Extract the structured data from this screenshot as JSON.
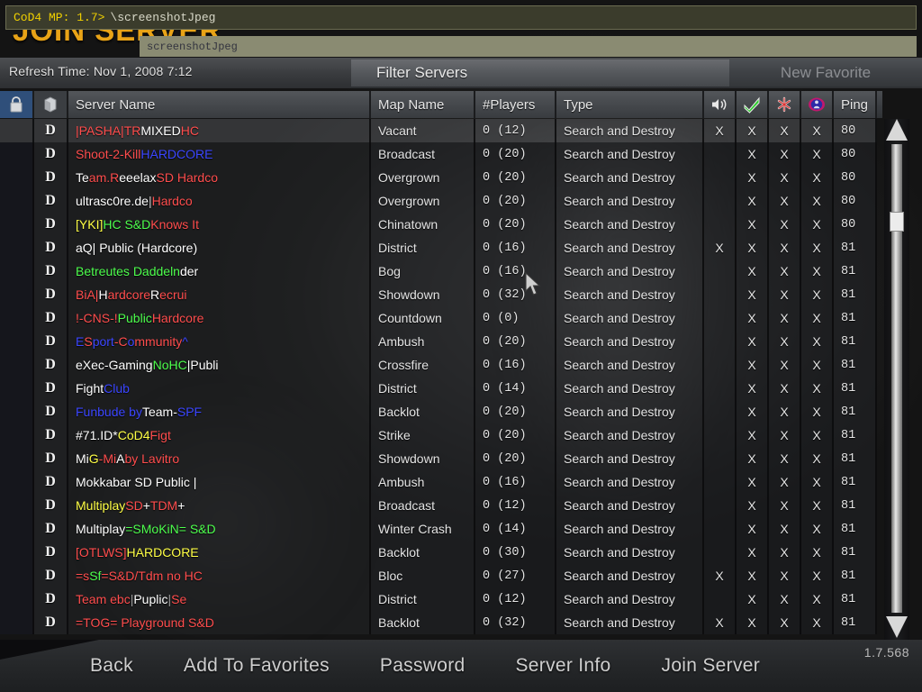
{
  "page_title": "JOIN SERVER",
  "console": {
    "prompt": "CoD4 MP: 1.7>",
    "command": "\\screenshotJpeg",
    "suggestion": "screenshotJpeg"
  },
  "refresh_time": "Refresh Time: Nov 1, 2008  7:12",
  "buttons": {
    "filter_servers": "Filter Servers",
    "new_favorite": "New Favorite"
  },
  "columns": {
    "lock_icon": "padlock-icon",
    "mod_icon": "cube-icon",
    "server_name": "Server Name",
    "map_name": "Map Name",
    "players": "#Players",
    "type": "Type",
    "voice_icon": "speaker-icon",
    "punkbuster_icon": "green-check-icon",
    "mod_star_icon": "red-asterisk-icon",
    "pure_icon": "person-globe-icon",
    "ping": "Ping"
  },
  "colors": {
    "title": "#e8a317",
    "console_bg": "#3b3c2c",
    "console_text": "#f0d000",
    "selected_row": "rgba(130,132,140,.30)",
    "cod_red": "#ff4d4d",
    "cod_green": "#4dff4d",
    "cod_blue": "#3b46ff",
    "cod_yellow": "#ffff45",
    "cod_white": "#ffffff"
  },
  "rows": [
    {
      "mod": "D",
      "name_parts": [
        {
          "t": "|PASHA|",
          "c": "#ff4d4d"
        },
        {
          "t": "TR ",
          "c": "#ff4d4d"
        },
        {
          "t": "MIXED ",
          "c": "#ffffff"
        },
        {
          "t": "HC",
          "c": "#ff4d4d"
        }
      ],
      "map": "Vacant",
      "players": "0 (12)",
      "type": "Search and Destroy",
      "voice": "X",
      "pb": "X",
      "modx": "X",
      "pure": "X",
      "ping": "80",
      "selected": true
    },
    {
      "mod": "D",
      "name_parts": [
        {
          "t": "Shoot-2-Kill ",
          "c": "#ff4d4d"
        },
        {
          "t": "HARDCORE",
          "c": "#3b46ff"
        }
      ],
      "map": "Broadcast",
      "players": "0 (20)",
      "type": "Search and Destroy",
      "voice": "",
      "pb": "X",
      "modx": "X",
      "pure": "X",
      "ping": "80",
      "selected": false
    },
    {
      "mod": "D",
      "name_parts": [
        {
          "t": "Te",
          "c": "#ffffff"
        },
        {
          "t": "am.R",
          "c": "#ff4d4d"
        },
        {
          "t": "eeelax ",
          "c": "#ffffff"
        },
        {
          "t": "SD Hardco",
          "c": "#ff4d4d"
        }
      ],
      "map": "Overgrown",
      "players": "0 (20)",
      "type": "Search and Destroy",
      "voice": "",
      "pb": "X",
      "modx": "X",
      "pure": "X",
      "ping": "80",
      "selected": false
    },
    {
      "mod": "D",
      "name_parts": [
        {
          "t": "ultrasc0re.de ",
          "c": "#ffffff"
        },
        {
          "t": "| ",
          "c": "#c8c8c8"
        },
        {
          "t": "Hardco",
          "c": "#ff4d4d"
        }
      ],
      "map": "Overgrown",
      "players": "0 (20)",
      "type": "Search and Destroy",
      "voice": "",
      "pb": "X",
      "modx": "X",
      "pure": "X",
      "ping": "80",
      "selected": false
    },
    {
      "mod": "D",
      "name_parts": [
        {
          "t": "[YKI]",
          "c": "#ffff45"
        },
        {
          "t": "HC S&D ",
          "c": "#4dff4d"
        },
        {
          "t": "Knows It",
          "c": "#ff4d4d"
        }
      ],
      "map": "Chinatown",
      "players": "0 (20)",
      "type": "Search and Destroy",
      "voice": "",
      "pb": "X",
      "modx": "X",
      "pure": "X",
      "ping": "80",
      "selected": false
    },
    {
      "mod": "D",
      "name_parts": [
        {
          "t": "aQ| Public (Hardcore)",
          "c": "#ffffff"
        }
      ],
      "map": "District",
      "players": "0 (16)",
      "type": "Search and Destroy",
      "voice": "X",
      "pb": "X",
      "modx": "X",
      "pure": "X",
      "ping": "81",
      "selected": false
    },
    {
      "mod": "D",
      "name_parts": [
        {
          "t": "Betreutes Daddeln ",
          "c": "#4dff4d"
        },
        {
          "t": "der",
          "c": "#ffffff"
        }
      ],
      "map": "Bog",
      "players": "0 (16)",
      "type": "Search and Destroy",
      "voice": "",
      "pb": "X",
      "modx": "X",
      "pure": "X",
      "ping": "81",
      "selected": false
    },
    {
      "mod": "D",
      "name_parts": [
        {
          "t": "BiA|",
          "c": "#ff4d4d"
        },
        {
          "t": "H",
          "c": "#ffffff"
        },
        {
          "t": "ardcore ",
          "c": "#ff4d4d"
        },
        {
          "t": "R",
          "c": "#ffffff"
        },
        {
          "t": "ecrui",
          "c": "#ff4d4d"
        }
      ],
      "map": "Showdown",
      "players": "0 (32)",
      "type": "Search and Destroy",
      "voice": "",
      "pb": "X",
      "modx": "X",
      "pure": "X",
      "ping": "81",
      "selected": false
    },
    {
      "mod": "D",
      "name_parts": [
        {
          "t": "!-CNS-! ",
          "c": "#ff4d4d"
        },
        {
          "t": "Public",
          "c": "#4dff4d"
        },
        {
          "t": "Hardcore",
          "c": "#ff4d4d"
        }
      ],
      "map": "Countdown",
      "players": "0 (0)",
      "type": "Search and Destroy",
      "voice": "",
      "pb": "X",
      "modx": "X",
      "pure": "X",
      "ping": "81",
      "selected": false
    },
    {
      "mod": "D",
      "name_parts": [
        {
          "t": "E",
          "c": "#3b46ff"
        },
        {
          "t": "S",
          "c": "#ff4d4d"
        },
        {
          "t": "port",
          "c": "#3b46ff"
        },
        {
          "t": "-C",
          "c": "#ff4d4d"
        },
        {
          "t": "o",
          "c": "#3b46ff"
        },
        {
          "t": "mmunity",
          "c": "#ff4d4d"
        },
        {
          "t": "^",
          "c": "#3b46ff"
        }
      ],
      "map": "Ambush",
      "players": "0 (20)",
      "type": "Search and Destroy",
      "voice": "",
      "pb": "X",
      "modx": "X",
      "pure": "X",
      "ping": "81",
      "selected": false
    },
    {
      "mod": "D",
      "name_parts": [
        {
          "t": "eXec-Gaming ",
          "c": "#ffffff"
        },
        {
          "t": "NoHC",
          "c": "#4dff4d"
        },
        {
          "t": "|Publi",
          "c": "#ffffff"
        }
      ],
      "map": "Crossfire",
      "players": "0 (16)",
      "type": "Search and Destroy",
      "voice": "",
      "pb": "X",
      "modx": "X",
      "pure": "X",
      "ping": "81",
      "selected": false
    },
    {
      "mod": "D",
      "name_parts": [
        {
          "t": "Fight ",
          "c": "#ffffff"
        },
        {
          "t": "Club",
          "c": "#3b46ff"
        }
      ],
      "map": "District",
      "players": "0 (14)",
      "type": "Search and Destroy",
      "voice": "",
      "pb": "X",
      "modx": "X",
      "pure": "X",
      "ping": "81",
      "selected": false
    },
    {
      "mod": "D",
      "name_parts": [
        {
          "t": "Funbude by ",
          "c": "#3b46ff"
        },
        {
          "t": "Team-",
          "c": "#ffffff"
        },
        {
          "t": "SPF",
          "c": "#3b46ff"
        }
      ],
      "map": "Backlot",
      "players": "0 (20)",
      "type": "Search and Destroy",
      "voice": "",
      "pb": "X",
      "modx": "X",
      "pure": "X",
      "ping": "81",
      "selected": false
    },
    {
      "mod": "D",
      "name_parts": [
        {
          "t": "#71.ID* ",
          "c": "#ffffff"
        },
        {
          "t": "CoD4 ",
          "c": "#ffff45"
        },
        {
          "t": "Figt",
          "c": "#ff4d4d"
        }
      ],
      "map": "Strike",
      "players": "0 (20)",
      "type": "Search and Destroy",
      "voice": "",
      "pb": "X",
      "modx": "X",
      "pure": "X",
      "ping": "81",
      "selected": false
    },
    {
      "mod": "D",
      "name_parts": [
        {
          "t": "Mi",
          "c": "#ffffff"
        },
        {
          "t": "G",
          "c": "#ffff45"
        },
        {
          "t": "-Mi",
          "c": "#ff4d4d"
        },
        {
          "t": "A",
          "c": "#ffffff"
        },
        {
          "t": "  by Lavitro",
          "c": "#ff4d4d"
        }
      ],
      "map": "Showdown",
      "players": "0 (20)",
      "type": "Search and Destroy",
      "voice": "",
      "pb": "X",
      "modx": "X",
      "pure": "X",
      "ping": "81",
      "selected": false
    },
    {
      "mod": "D",
      "name_parts": [
        {
          "t": "Mokkabar SD Public |",
          "c": "#ffffff"
        }
      ],
      "map": "Ambush",
      "players": "0 (16)",
      "type": "Search and Destroy",
      "voice": "",
      "pb": "X",
      "modx": "X",
      "pure": "X",
      "ping": "81",
      "selected": false
    },
    {
      "mod": "D",
      "name_parts": [
        {
          "t": "Multiplay ",
          "c": "#ffff45"
        },
        {
          "t": "SD ",
          "c": "#ff4d4d"
        },
        {
          "t": "+ ",
          "c": "#ffffff"
        },
        {
          "t": "TDM ",
          "c": "#ff4d4d"
        },
        {
          "t": "+",
          "c": "#ffffff"
        }
      ],
      "map": "Broadcast",
      "players": "0 (12)",
      "type": "Search and Destroy",
      "voice": "",
      "pb": "X",
      "modx": "X",
      "pure": "X",
      "ping": "81",
      "selected": false
    },
    {
      "mod": "D",
      "name_parts": [
        {
          "t": "Multiplay",
          "c": "#ffffff"
        },
        {
          "t": "=SMoKiN= S&D",
          "c": "#4dff4d"
        }
      ],
      "map": "Winter Crash",
      "players": "0 (14)",
      "type": "Search and Destroy",
      "voice": "",
      "pb": "X",
      "modx": "X",
      "pure": "X",
      "ping": "81",
      "selected": false
    },
    {
      "mod": "D",
      "name_parts": [
        {
          "t": "[OTLWS]",
          "c": "#ff4d4d"
        },
        {
          "t": "HARDCORE",
          "c": "#ffff45"
        }
      ],
      "map": "Backlot",
      "players": "0 (30)",
      "type": "Search and Destroy",
      "voice": "",
      "pb": "X",
      "modx": "X",
      "pure": "X",
      "ping": "81",
      "selected": false
    },
    {
      "mod": "D",
      "name_parts": [
        {
          "t": "=s",
          "c": "#ff4d4d"
        },
        {
          "t": "Sf",
          "c": "#4dff4d"
        },
        {
          "t": "=S&D/Tdm no HC",
          "c": "#ff4d4d"
        }
      ],
      "map": "Bloc",
      "players": "0 (27)",
      "type": "Search and Destroy",
      "voice": "X",
      "pb": "X",
      "modx": "X",
      "pure": "X",
      "ping": "81",
      "selected": false
    },
    {
      "mod": "D",
      "name_parts": [
        {
          "t": "Team ebc ",
          "c": "#ff4d4d"
        },
        {
          "t": "| ",
          "c": "#9a9a9a"
        },
        {
          "t": "Puplic ",
          "c": "#ffffff"
        },
        {
          "t": "| ",
          "c": "#9a9a9a"
        },
        {
          "t": "Se",
          "c": "#ff4d4d"
        }
      ],
      "map": "District",
      "players": "0 (12)",
      "type": "Search and Destroy",
      "voice": "",
      "pb": "X",
      "modx": "X",
      "pure": "X",
      "ping": "81",
      "selected": false
    },
    {
      "mod": "D",
      "name_parts": [
        {
          "t": "=TOG= Playground S&D",
          "c": "#ff4d4d"
        }
      ],
      "map": "Backlot",
      "players": "0 (32)",
      "type": "Search and Destroy",
      "voice": "X",
      "pb": "X",
      "modx": "X",
      "pure": "X",
      "ping": "81",
      "selected": false
    }
  ],
  "menu": [
    {
      "label": "Back"
    },
    {
      "label": "Add To Favorites"
    },
    {
      "label": "Password"
    },
    {
      "label": "Server Info"
    },
    {
      "label": "Join Server"
    }
  ],
  "version": "1.7.568"
}
